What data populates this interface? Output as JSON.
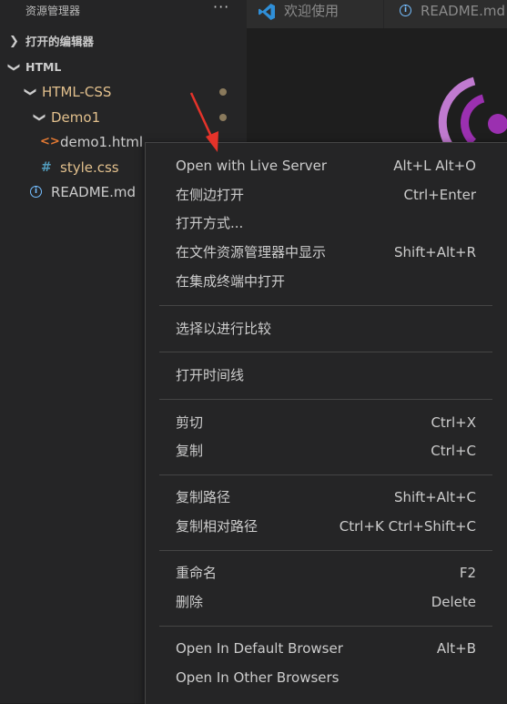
{
  "sidebar": {
    "title": "资源管理器",
    "more": "···",
    "open_editors": "打开的编辑器",
    "section": "HTML",
    "tree": {
      "folder1": "HTML-CSS",
      "folder2": "Demo1",
      "file1": "demo1.html",
      "file2": "style.css",
      "file3": "README.md"
    }
  },
  "tabs": [
    {
      "label": "欢迎使用"
    },
    {
      "label": "README.md"
    }
  ],
  "menu": {
    "items": [
      {
        "label": "Open with Live Server",
        "key": "Alt+L Alt+O"
      },
      {
        "label": "在侧边打开",
        "key": "Ctrl+Enter"
      },
      {
        "label": "打开方式...",
        "key": ""
      },
      {
        "label": "在文件资源管理器中显示",
        "key": "Shift+Alt+R"
      },
      {
        "label": "在集成终端中打开",
        "key": ""
      },
      {
        "label": "选择以进行比较",
        "key": ""
      },
      {
        "label": "打开时间线",
        "key": ""
      },
      {
        "label": "剪切",
        "key": "Ctrl+X"
      },
      {
        "label": "复制",
        "key": "Ctrl+C"
      },
      {
        "label": "复制路径",
        "key": "Shift+Alt+C"
      },
      {
        "label": "复制相对路径",
        "key": "Ctrl+K Ctrl+Shift+C"
      },
      {
        "label": "重命名",
        "key": "F2"
      },
      {
        "label": "删除",
        "key": "Delete"
      },
      {
        "label": "Open In Default Browser",
        "key": "Alt+B"
      },
      {
        "label": "Open In Other Browsers",
        "key": ""
      }
    ]
  },
  "colors": {
    "accent": "#007acc",
    "folder": "#e2c08d",
    "arrow": "#e5332a",
    "live_logo": "#9b30b0"
  }
}
